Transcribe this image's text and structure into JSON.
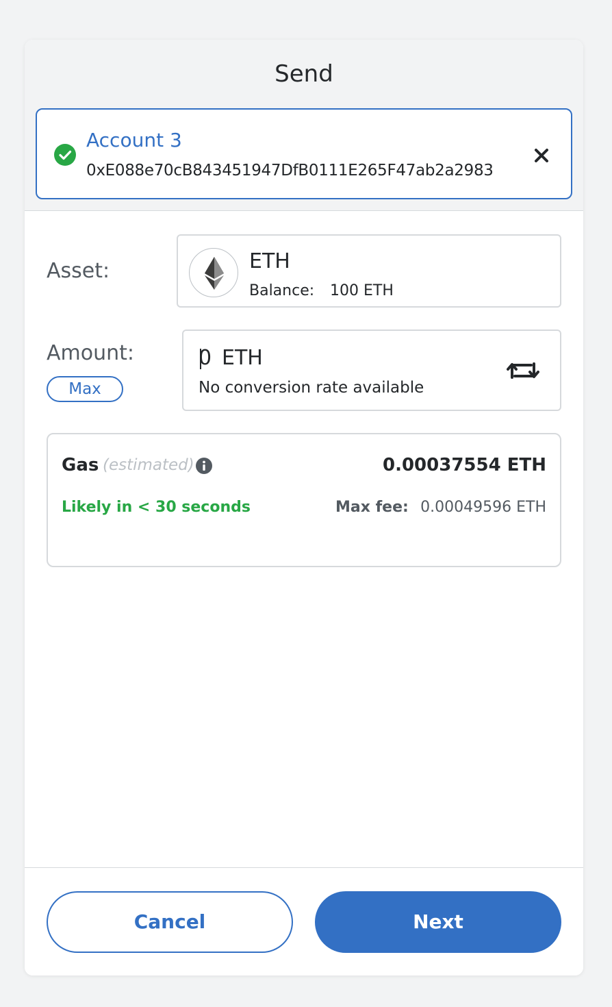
{
  "header": {
    "title": "Send"
  },
  "recipient": {
    "name": "Account 3",
    "address": "0xE088e70cB843451947DfB0111E265F47ab2a2983",
    "status_color": "#28a745"
  },
  "asset": {
    "label": "Asset:",
    "name": "ETH",
    "balance_label": "Balance:",
    "balance_value": "100 ETH",
    "icon": "ethereum-icon"
  },
  "amount": {
    "label": "Amount:",
    "max_label": "Max",
    "value": "0",
    "unit": "ETH",
    "conversion_text": "No conversion rate available",
    "swap_icon": "swap-icon"
  },
  "gas": {
    "title": "Gas",
    "estimated_label": "(estimated)",
    "amount": "0.00037554 ETH",
    "likely_text": "Likely in < 30 seconds",
    "max_fee_label": "Max fee:",
    "max_fee_value": "0.00049596 ETH",
    "likely_color": "#28a745"
  },
  "footer": {
    "cancel_label": "Cancel",
    "next_label": "Next",
    "accent_color": "#3370c4"
  }
}
